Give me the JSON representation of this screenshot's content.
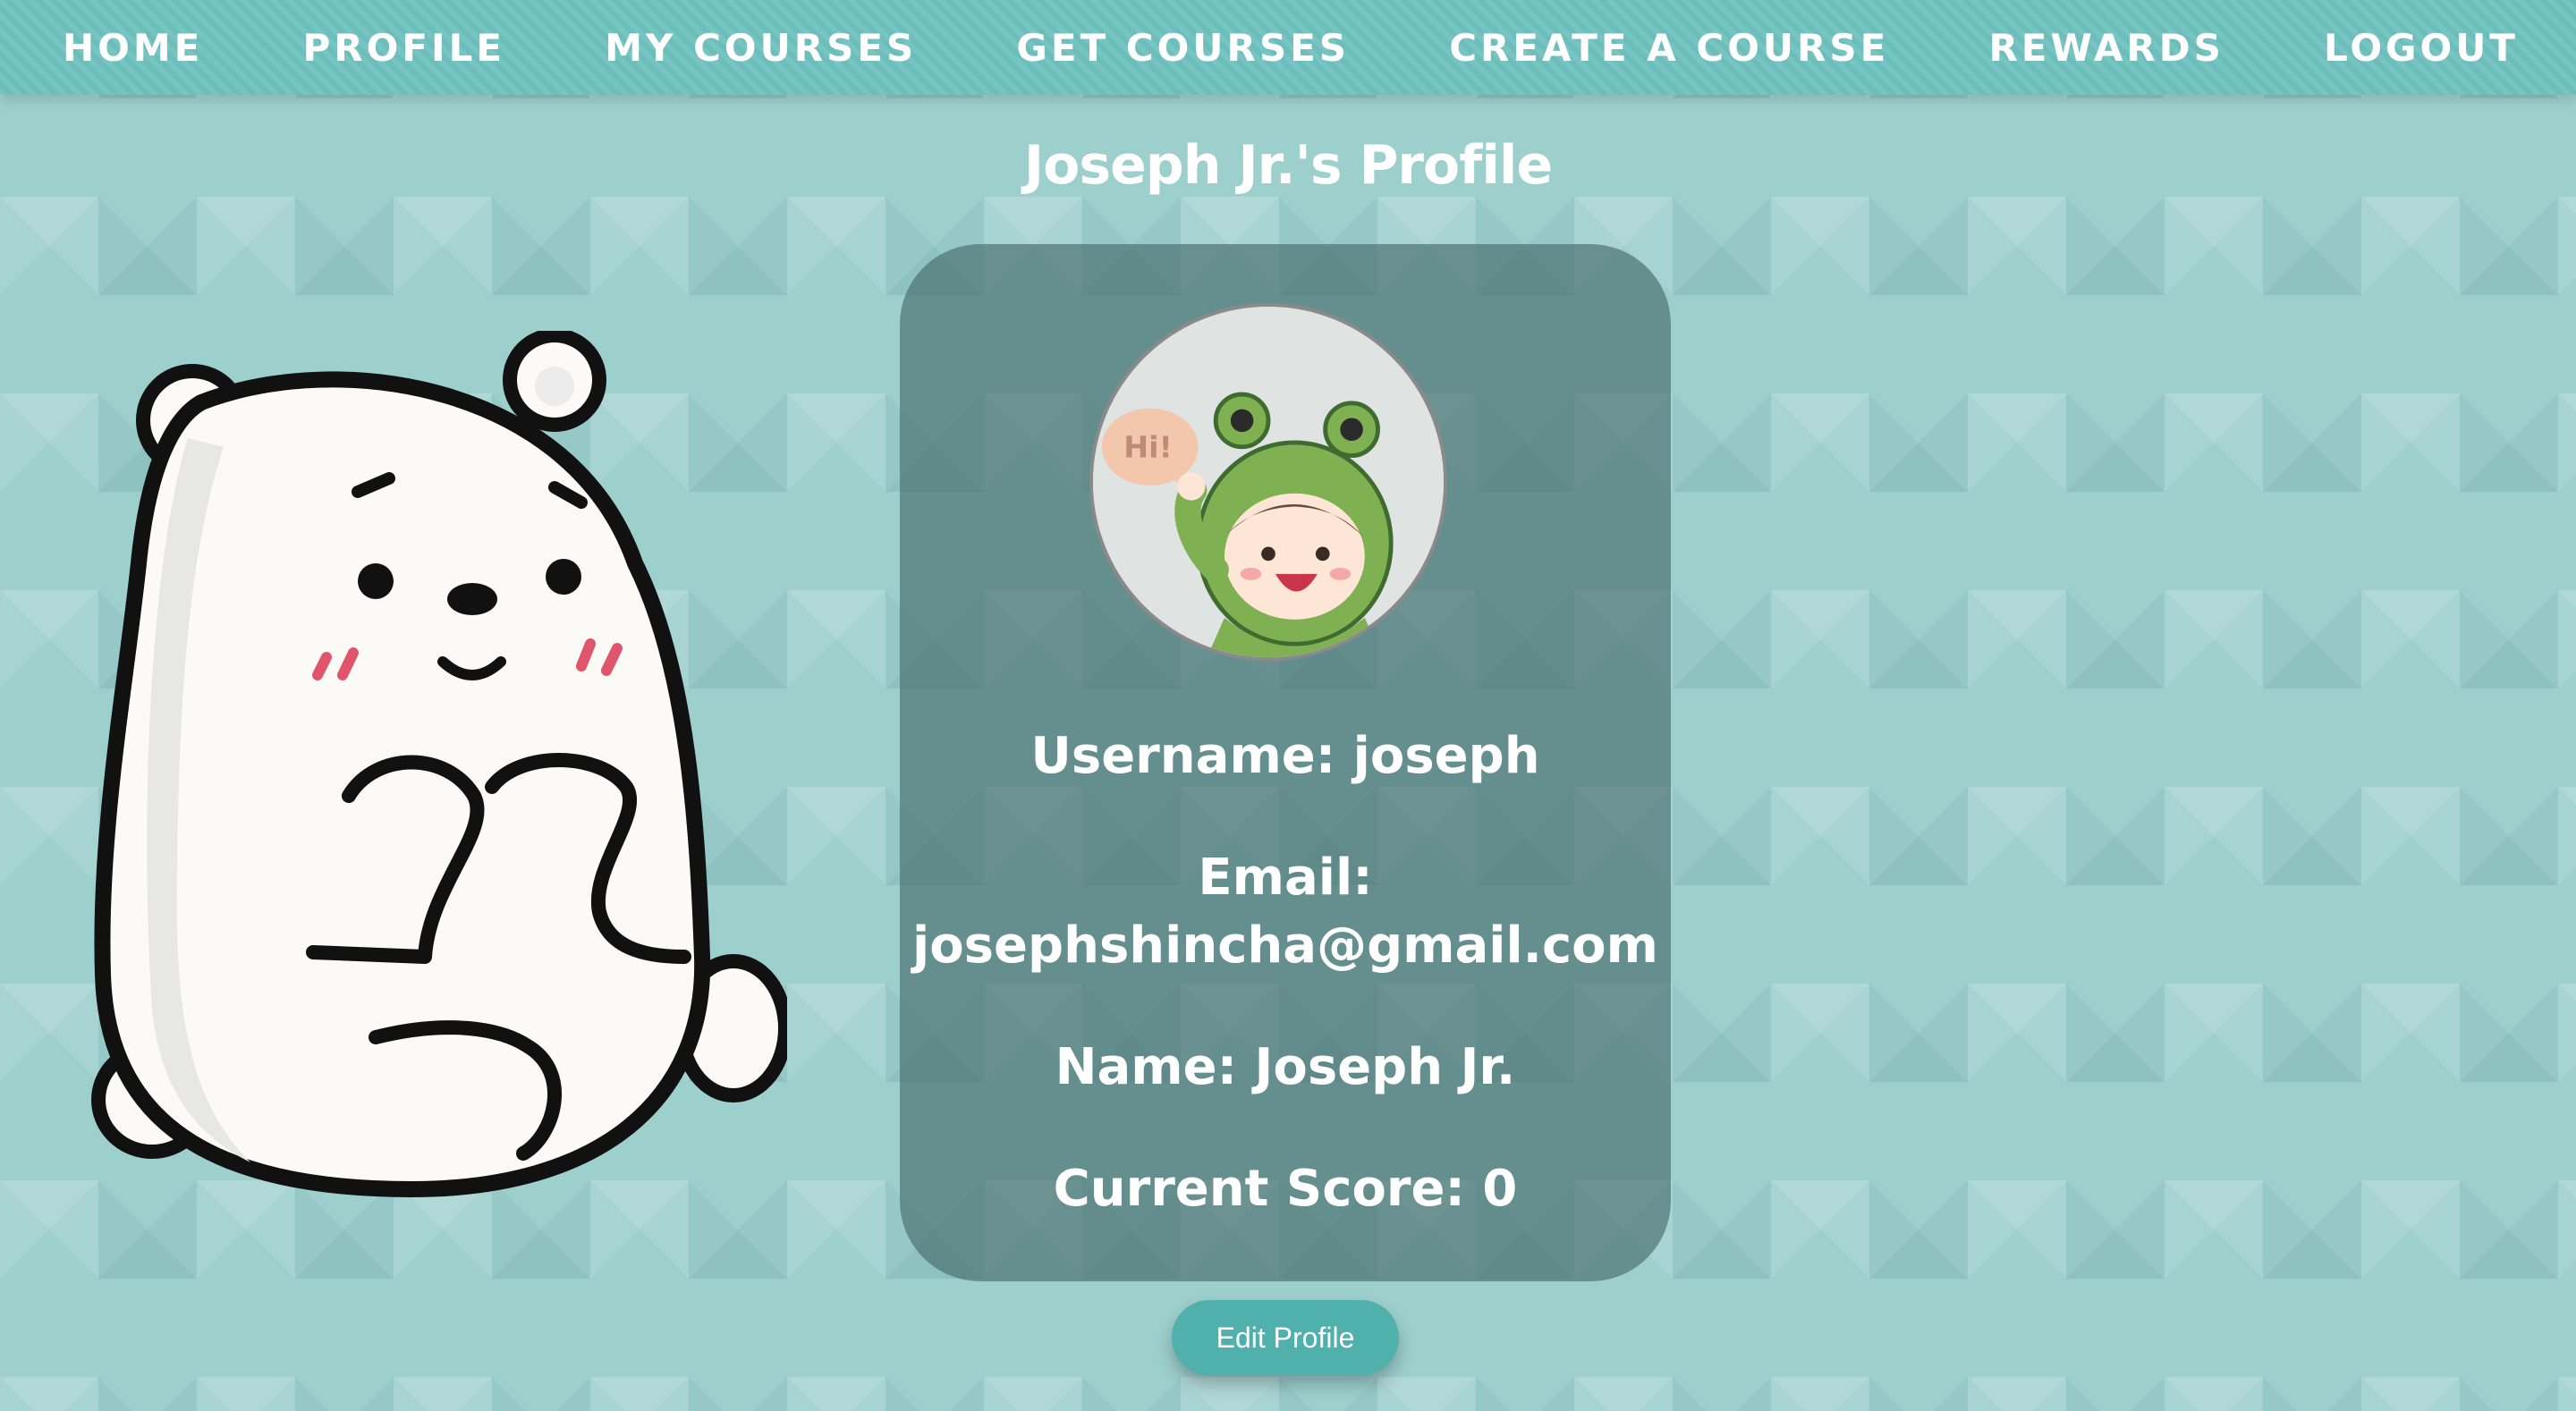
{
  "nav": {
    "items": [
      "HOME",
      "PROFILE",
      "MY COURSES",
      "GET COURSES",
      "CREATE A COURSE",
      "REWARDS",
      "LOGOUT"
    ]
  },
  "page": {
    "title": "Joseph Jr.'s Profile"
  },
  "profile": {
    "avatar_bubble_text": "Hi!",
    "username_line": "Username: joseph",
    "email_label": "Email:",
    "email_value": "josephshincha@gmail.com",
    "name_line": "Name: Joseph Jr.",
    "score_line": "Current Score: 0"
  },
  "actions": {
    "edit_label": "Edit Profile"
  },
  "colors": {
    "navbar": "#6fc2bf",
    "background": "#9dcfcd",
    "card": "#496d6d",
    "button": "#4fb0ac",
    "text": "#ffffff"
  },
  "icons": {
    "bear": "polar-bear-illustration",
    "avatar": "frog-hood-kid-illustration"
  }
}
